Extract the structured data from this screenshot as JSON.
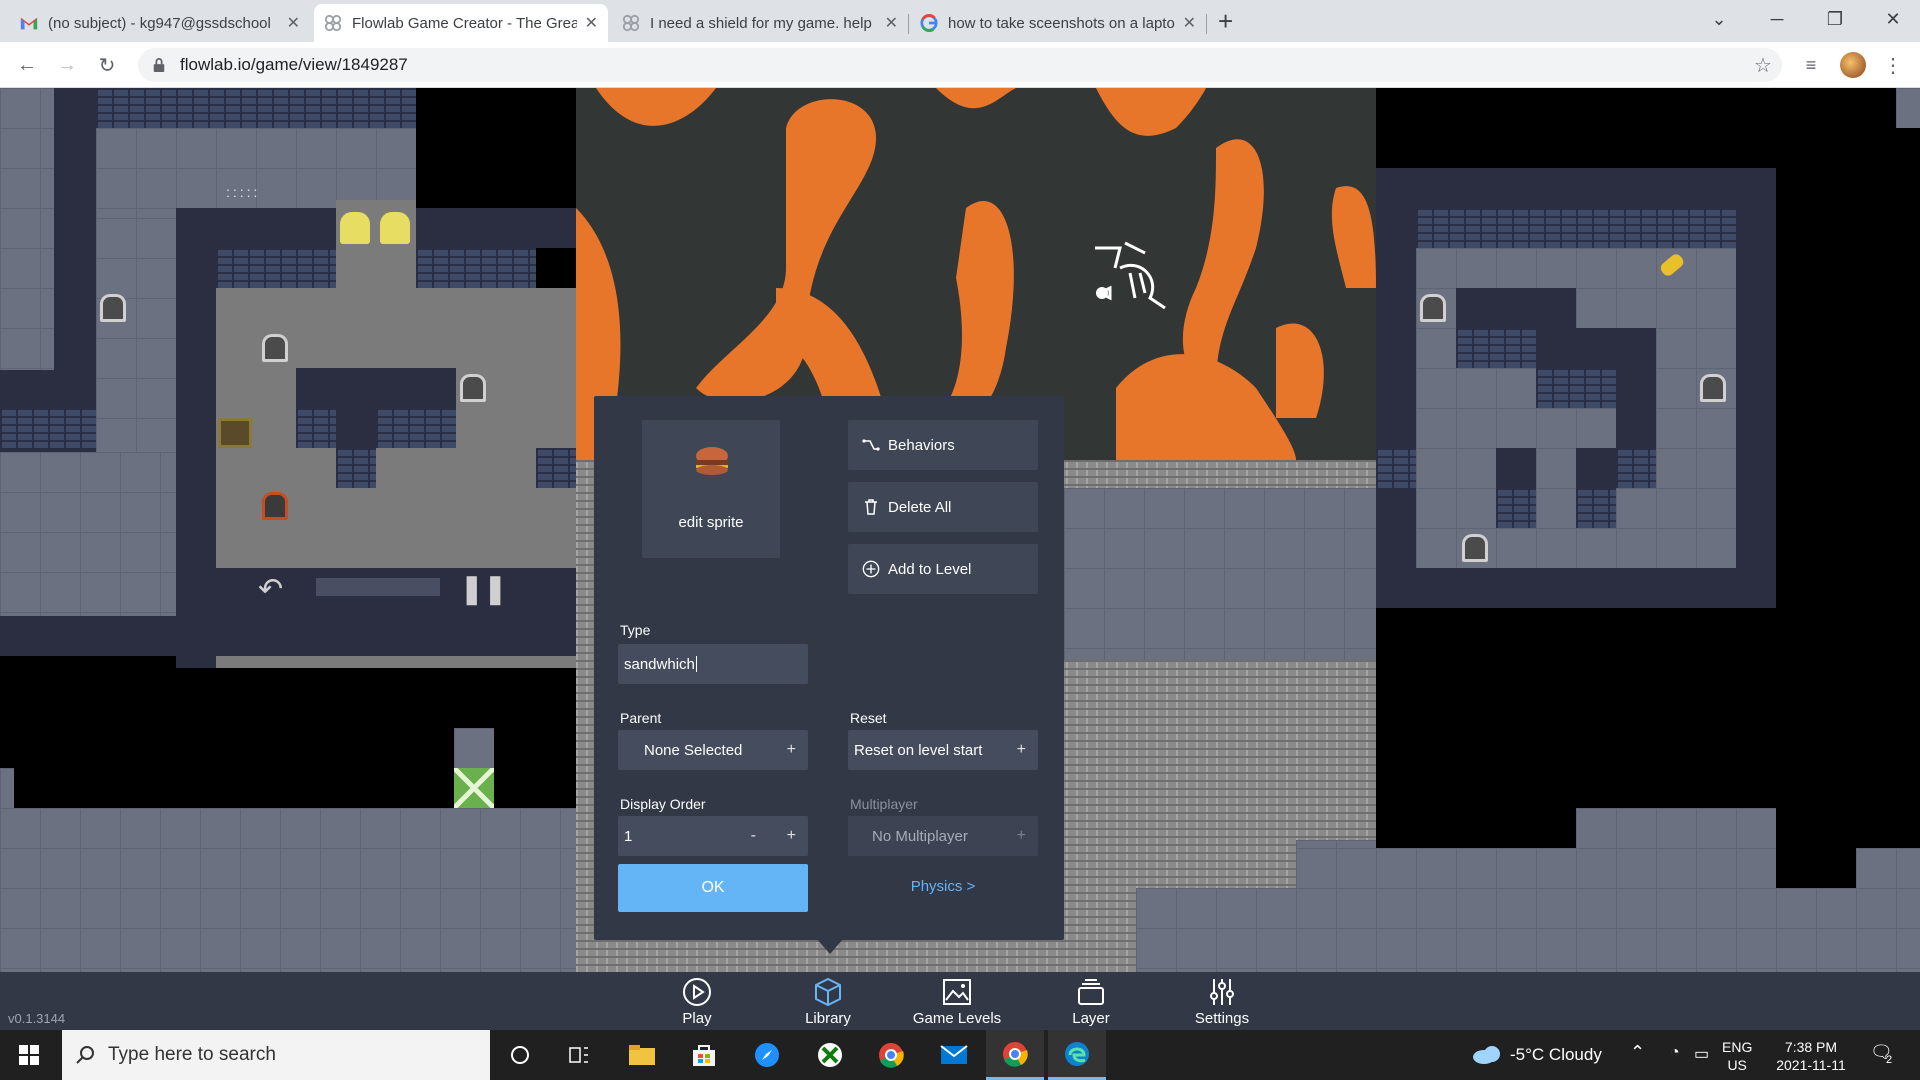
{
  "browser": {
    "tabs": [
      {
        "title": "(no subject) - kg947@gssdschool",
        "icon": "gmail-icon"
      },
      {
        "title": "Flowlab Game Creator - The Great",
        "icon": "flowlab-icon",
        "active": true
      },
      {
        "title": "I need a shield for my game. help",
        "icon": "flowlab-icon"
      },
      {
        "title": "how to take sceenshots on a laptop",
        "icon": "google-icon"
      }
    ],
    "new_tab": "+",
    "url": "flowlab.io/game/view/1849287"
  },
  "dialog": {
    "sprite_label": "edit sprite",
    "behaviors_label": "Behaviors",
    "delete_all_label": "Delete All",
    "add_to_level_label": "Add to Level",
    "type_label": "Type",
    "type_value": "sandwhich",
    "parent_label": "Parent",
    "parent_value": "None Selected",
    "reset_label": "Reset",
    "reset_value": "Reset on level start",
    "display_order_label": "Display Order",
    "display_order_value": "1",
    "display_order_minus": "-",
    "plus": "+",
    "multiplayer_label": "Multiplayer",
    "multiplayer_value": "No Multiplayer",
    "ok_label": "OK",
    "physics_label": "Physics >"
  },
  "bottom_bar": {
    "items": [
      {
        "label": "Play",
        "icon": "play-icon"
      },
      {
        "label": "Library",
        "icon": "cube-icon",
        "active": true
      },
      {
        "label": "Game Levels",
        "icon": "image-icon"
      },
      {
        "label": "Layer",
        "icon": "layers-icon"
      },
      {
        "label": "Settings",
        "icon": "sliders-icon"
      }
    ],
    "version": "v0.1.3144"
  },
  "taskbar": {
    "search_placeholder": "Type here to search",
    "weather": "-5°C  Cloudy",
    "lang_top": "ENG",
    "lang_bottom": "US",
    "time": "7:38 PM",
    "date": "2021-11-11",
    "notifications": "2"
  },
  "colors": {
    "accent": "#64b5f6",
    "dialog_bg": "#323846",
    "lava": "#e8762a"
  }
}
